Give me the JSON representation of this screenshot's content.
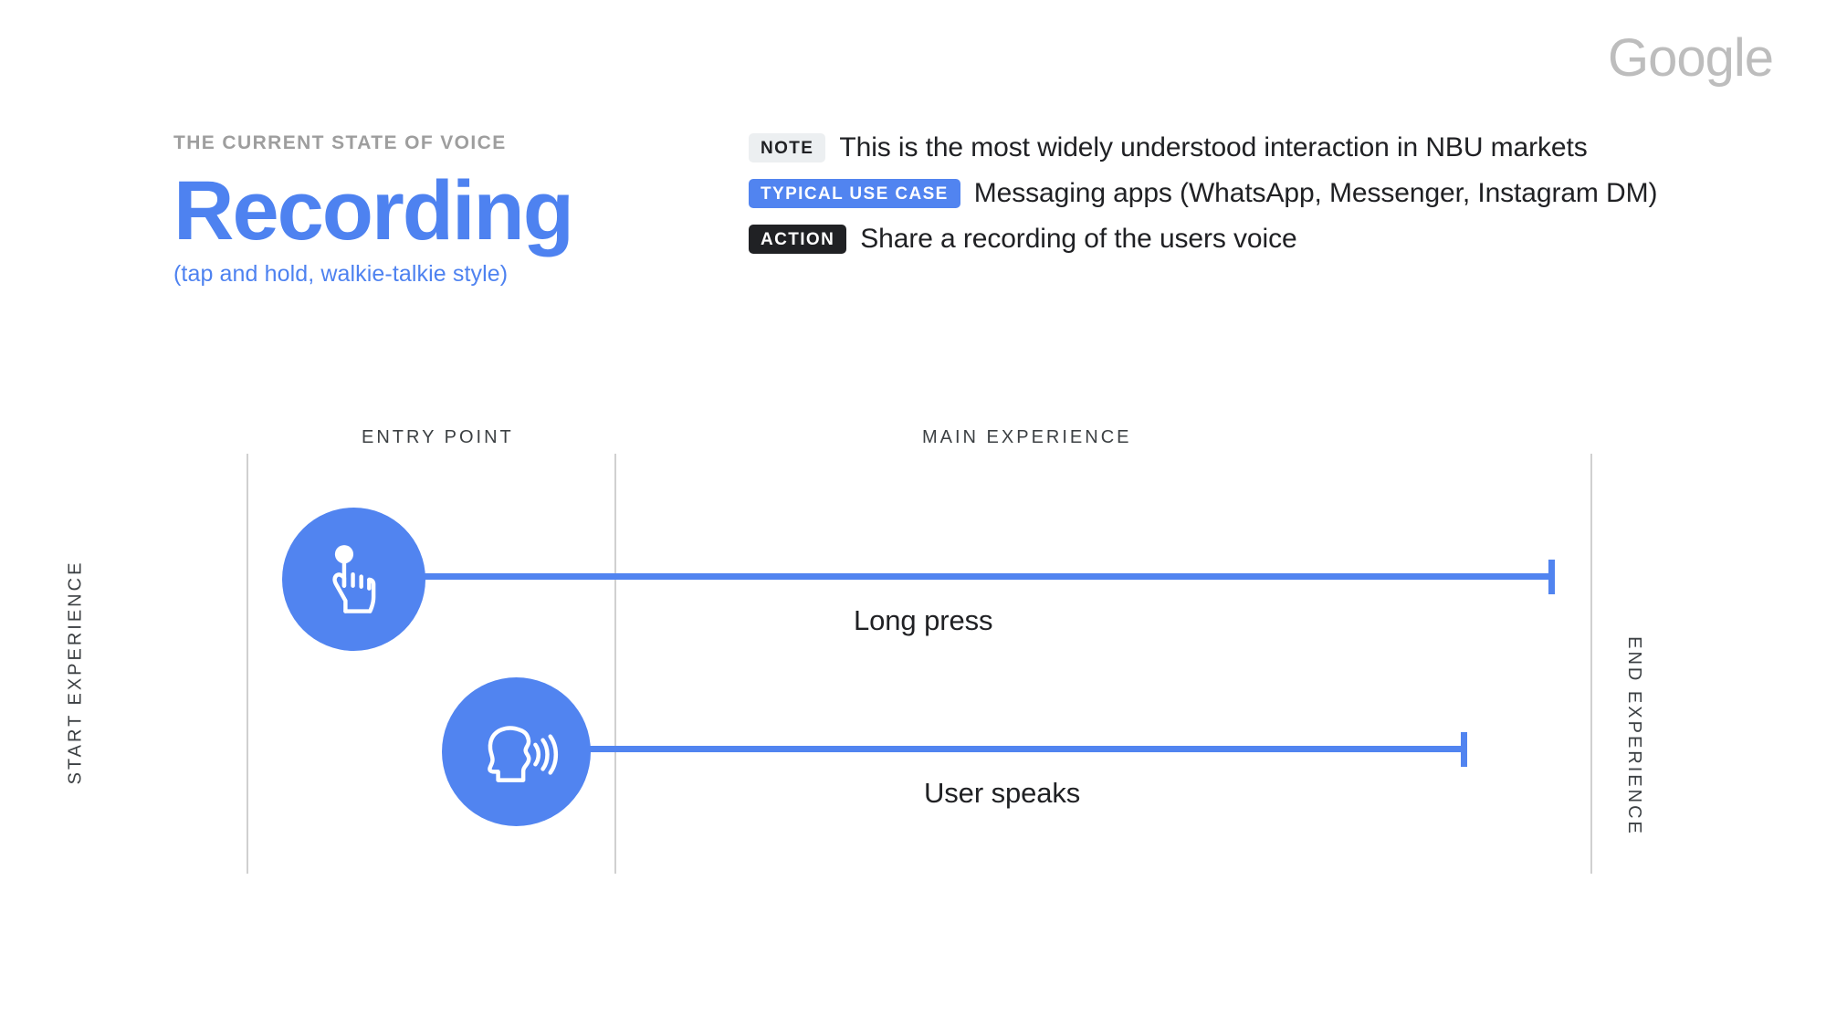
{
  "brand": {
    "logo_text": "Google"
  },
  "title_block": {
    "eyebrow": "THE CURRENT STATE OF VOICE",
    "headline": "Recording",
    "subhead": "(tap and hold, walkie-talkie style)"
  },
  "meta": {
    "rows": [
      {
        "badge": "NOTE",
        "text": "This is the most widely understood interaction in NBU markets",
        "style": "note"
      },
      {
        "badge": "TYPICAL USE CASE",
        "text": "Messaging apps (WhatsApp, Messenger, Instagram DM)",
        "style": "usecase"
      },
      {
        "badge": "ACTION",
        "text": "Share a recording of the users voice",
        "style": "action"
      }
    ]
  },
  "diagram": {
    "column_headers": {
      "entry_point": "ENTRY POINT",
      "main_experience": "MAIN EXPERIENCE"
    },
    "axis_labels": {
      "start": "START EXPERIENCE",
      "end": "END EXPERIENCE"
    },
    "tracks": [
      {
        "icon": "tap-hand-icon",
        "label": "Long press"
      },
      {
        "icon": "speaking-head-icon",
        "label": "User speaks"
      }
    ]
  },
  "colors": {
    "accent_blue": "#5184f0",
    "headline_blue": "#4e82f0",
    "eyebrow_gray": "#9e9e9e",
    "logo_gray": "#bdbdbd",
    "badge_note_bg": "#eceff1",
    "badge_action_bg": "#202124",
    "divider_gray": "#d0d0d0",
    "text_dark": "#202124",
    "background": "#ffffff"
  }
}
